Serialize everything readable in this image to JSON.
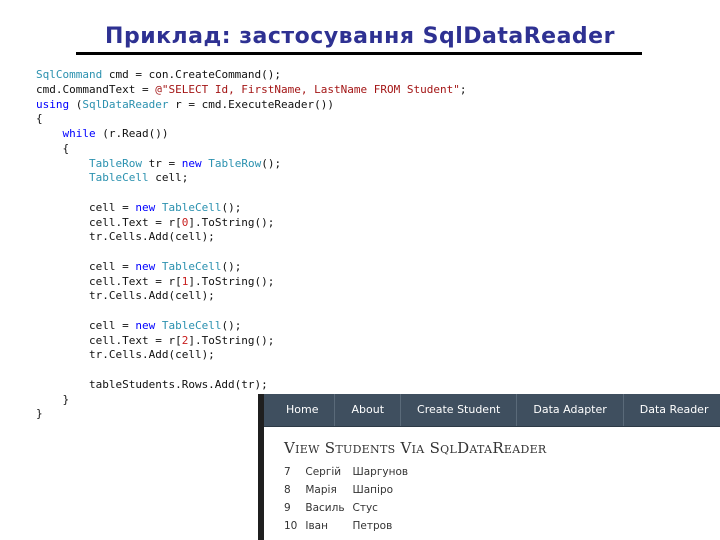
{
  "slide": {
    "title": "Приклад: застосування SqlDataReader"
  },
  "code_lines": [
    [
      {
        "t": "SqlCommand",
        "c": "type"
      },
      {
        "t": " cmd = con.CreateCommand();"
      }
    ],
    [
      {
        "t": "cmd.CommandText = "
      },
      {
        "t": "@\"SELECT Id, FirstName, LastName FROM Student\"",
        "c": "str"
      },
      {
        "t": ";"
      }
    ],
    [
      {
        "t": "using",
        "c": "kw"
      },
      {
        "t": " ("
      },
      {
        "t": "SqlDataReader",
        "c": "type"
      },
      {
        "t": " r = cmd.ExecuteReader())"
      }
    ],
    [
      {
        "t": "{"
      }
    ],
    [
      {
        "t": "    "
      },
      {
        "t": "while",
        "c": "kw"
      },
      {
        "t": " (r.Read())"
      }
    ],
    [
      {
        "t": "    {"
      }
    ],
    [
      {
        "t": "        "
      },
      {
        "t": "TableRow",
        "c": "type"
      },
      {
        "t": " tr = "
      },
      {
        "t": "new",
        "c": "kw"
      },
      {
        "t": " "
      },
      {
        "t": "TableRow",
        "c": "type"
      },
      {
        "t": "();"
      }
    ],
    [
      {
        "t": "        "
      },
      {
        "t": "TableCell",
        "c": "type"
      },
      {
        "t": " cell;"
      }
    ],
    [
      {
        "t": ""
      }
    ],
    [
      {
        "t": "        cell = "
      },
      {
        "t": "new",
        "c": "kw"
      },
      {
        "t": " "
      },
      {
        "t": "TableCell",
        "c": "type"
      },
      {
        "t": "();"
      }
    ],
    [
      {
        "t": "        cell.Text = r["
      },
      {
        "t": "0",
        "c": "num"
      },
      {
        "t": "].ToString();"
      }
    ],
    [
      {
        "t": "        tr.Cells.Add(cell);"
      }
    ],
    [
      {
        "t": ""
      }
    ],
    [
      {
        "t": "        cell = "
      },
      {
        "t": "new",
        "c": "kw"
      },
      {
        "t": " "
      },
      {
        "t": "TableCell",
        "c": "type"
      },
      {
        "t": "();"
      }
    ],
    [
      {
        "t": "        cell.Text = r["
      },
      {
        "t": "1",
        "c": "num"
      },
      {
        "t": "].ToString();"
      }
    ],
    [
      {
        "t": "        tr.Cells.Add(cell);"
      }
    ],
    [
      {
        "t": ""
      }
    ],
    [
      {
        "t": "        cell = "
      },
      {
        "t": "new",
        "c": "kw"
      },
      {
        "t": " "
      },
      {
        "t": "TableCell",
        "c": "type"
      },
      {
        "t": "();"
      }
    ],
    [
      {
        "t": "        cell.Text = r["
      },
      {
        "t": "2",
        "c": "num"
      },
      {
        "t": "].ToString();"
      }
    ],
    [
      {
        "t": "        tr.Cells.Add(cell);"
      }
    ],
    [
      {
        "t": ""
      }
    ],
    [
      {
        "t": "        tableStudents.Rows.Add(tr);"
      }
    ],
    [
      {
        "t": "    }"
      }
    ],
    [
      {
        "t": "}"
      }
    ]
  ],
  "app": {
    "nav": [
      "Home",
      "About",
      "Create Student",
      "Data Adapter",
      "Data Reader"
    ],
    "heading": "View Students Via SqlDataReader",
    "students": [
      [
        "7",
        "Сергій",
        "Шаргунов"
      ],
      [
        "8",
        "Марія",
        "Шапіро"
      ],
      [
        "9",
        "Василь",
        "Стус"
      ],
      [
        "10",
        "Іван",
        "Петров"
      ]
    ]
  },
  "colors": {
    "title": "#2e3192",
    "code_type": "#2b91af",
    "code_keyword": "#0000ff",
    "code_string": "#a31515",
    "code_number": "#c81e1e",
    "navbar": "#3f4f5f"
  }
}
